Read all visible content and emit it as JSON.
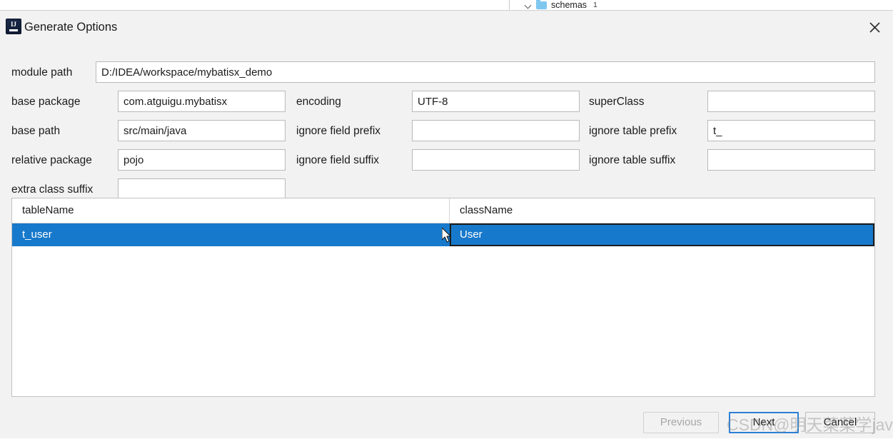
{
  "backdrop": {
    "tree_item": {
      "label": "schemas",
      "count": "1",
      "icon": "folder-icon"
    }
  },
  "dialog": {
    "title": "Generate Options",
    "icon": "intellij-idea-icon",
    "close_icon": "close-icon"
  },
  "form": {
    "fields": [
      {
        "label": "module path",
        "value": "D:/IDEA/workspace/mybatisx_demo"
      },
      {
        "label": "base package",
        "value": "com.atguigu.mybatisx"
      },
      {
        "label": "encoding",
        "value": "UTF-8"
      },
      {
        "label": "superClass",
        "value": ""
      },
      {
        "label": "base path",
        "value": "src/main/java"
      },
      {
        "label": "ignore field prefix",
        "value": ""
      },
      {
        "label": "ignore table prefix",
        "value": "t_"
      },
      {
        "label": "relative package",
        "value": "pojo"
      },
      {
        "label": "ignore field suffix",
        "value": ""
      },
      {
        "label": "ignore table suffix",
        "value": ""
      },
      {
        "label": "extra class suffix",
        "value": ""
      }
    ]
  },
  "table": {
    "columns": [
      "tableName",
      "className"
    ],
    "rows": [
      {
        "tableName": "t_user",
        "className": "User",
        "selected": true
      }
    ]
  },
  "footer": {
    "previous_label": "Previous",
    "next_label": "Next",
    "cancel_label": "Cancel"
  },
  "watermark": {
    "text": "CSDN@明天菜菜学java"
  },
  "colors": {
    "selection_blue": "#1779cb",
    "focus_blue": "#2b7fd4",
    "dialog_bg": "#f2f2f2",
    "folder_blue": "#7fc7ef"
  }
}
